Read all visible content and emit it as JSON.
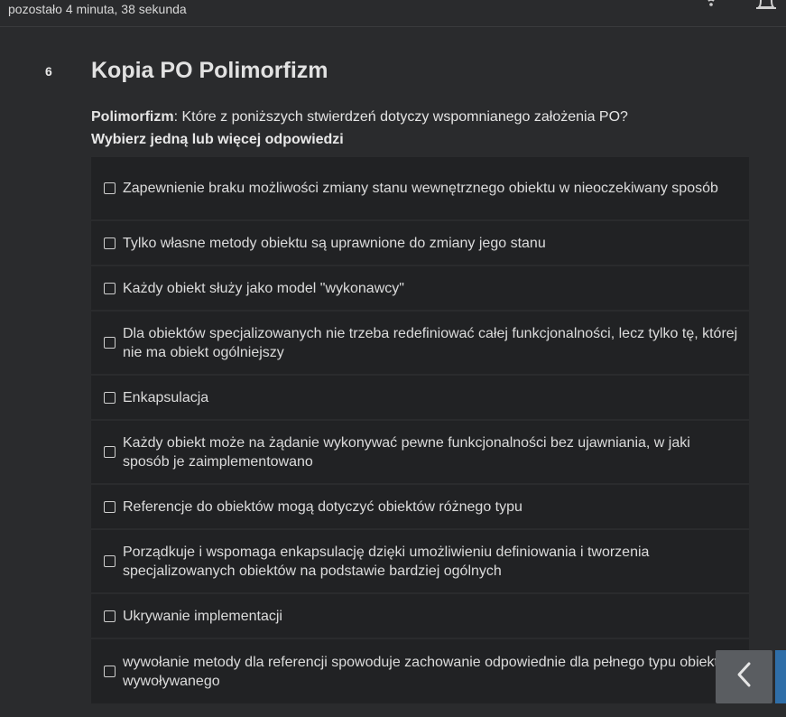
{
  "header": {
    "timer_text": "pozostało 4 minuta, 38 sekunda",
    "icons": [
      "wifi-icon",
      "bell-icon"
    ]
  },
  "question": {
    "number": "6",
    "title": "Kopia PO Polimorfizm",
    "topic": "Polimorfizm",
    "text": ": Które z poniższych stwierdzeń dotyczy wspomnianego założenia PO?",
    "instruction": "Wybierz jedną lub więcej odpowiedzi",
    "options": [
      {
        "label": "Zapewnienie braku możliwości zmiany stanu wewnętrznego obiektu w nieoczekiwany sposób",
        "checked": false
      },
      {
        "label": "Tylko własne metody obiektu są uprawnione do zmiany jego stanu",
        "checked": false
      },
      {
        "label": "Każdy obiekt służy jako model \"wykonawcy\"",
        "checked": false
      },
      {
        "label": "Dla obiektów specjalizowanych nie trzeba redefiniować całej funkcjonalności, lecz tylko tę, której nie ma obiekt ogólniejszy",
        "checked": false
      },
      {
        "label": "Enkapsulacja",
        "checked": false
      },
      {
        "label": "Każdy obiekt może na żądanie wykonywać pewne funkcjonalności bez ujawniania, w jaki sposób je zaimplementowano",
        "checked": false
      },
      {
        "label": "Referencje do obiektów mogą dotyczyć obiektów różnego typu",
        "checked": false
      },
      {
        "label": "Porządkuje i wspomaga enkapsulację dzięki umożliwieniu definiowania i tworzenia specjalizowanych obiektów na podstawie bardziej ogólnych",
        "checked": false
      },
      {
        "label": "Ukrywanie implementacji",
        "checked": false
      },
      {
        "label": "wywołanie metody dla referencji spowoduje zachowanie odpowiednie dla pełnego typu obiektu wywoływanego",
        "checked": false
      }
    ]
  },
  "navigation": {
    "prev_icon": "chevron-left-icon"
  },
  "colors": {
    "background": "#2a2b2d",
    "option_background": "#212224",
    "nav_button": "#5a5d61",
    "accent": "#2f6ea8"
  }
}
